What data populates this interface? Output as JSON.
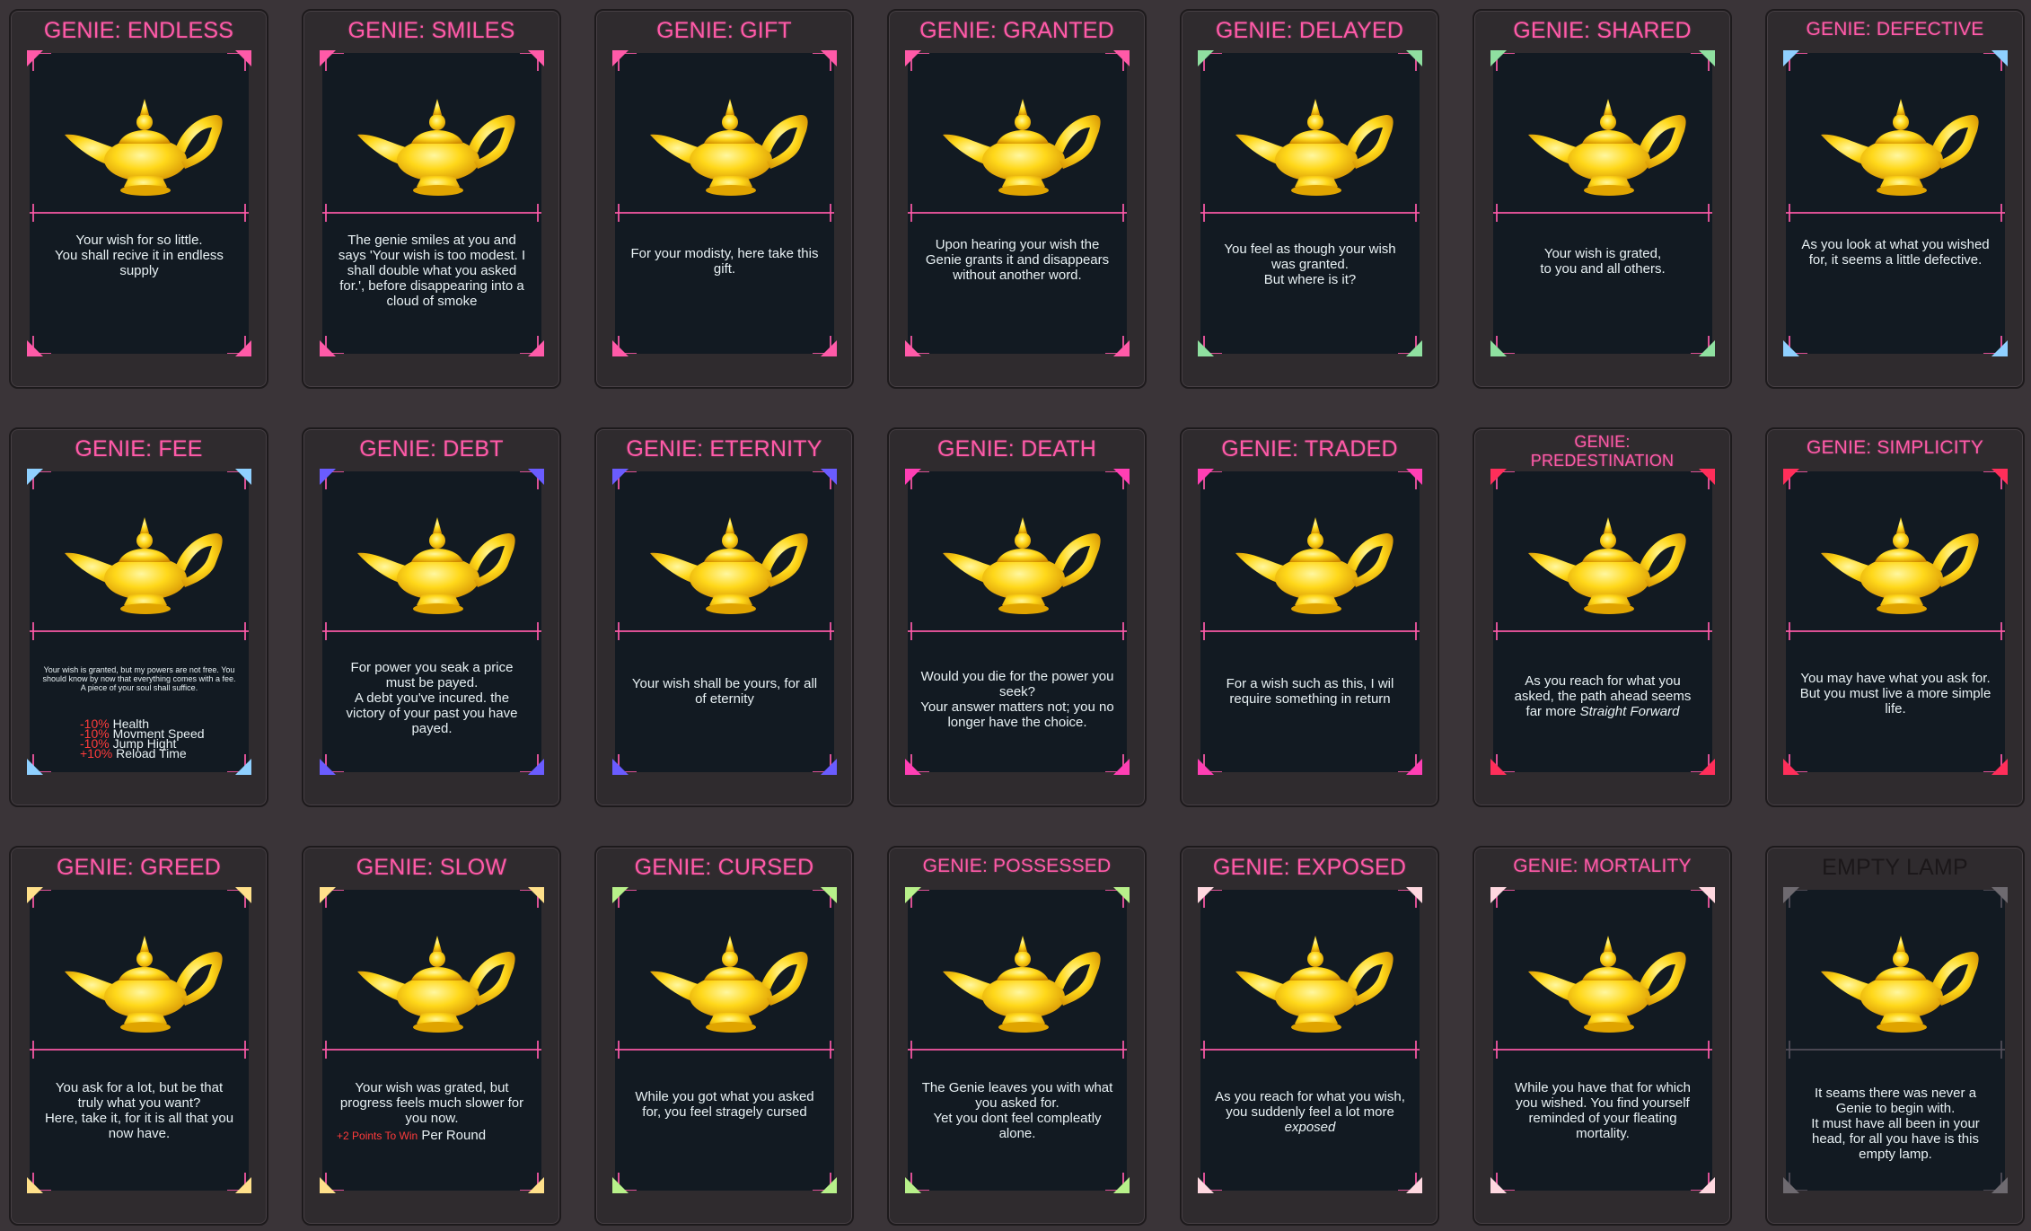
{
  "cards": [
    {
      "title": "GENIE: ENDLESS",
      "text": "Your wish for so little.\nYou shall recive it in endless supply",
      "corner_color": "#ff5aa8"
    },
    {
      "title": "GENIE: SMILES",
      "text": "The genie smiles at you and says 'Your wish is too modest. I shall double what you asked for.', before disappearing into a cloud of smoke",
      "corner_color": "#ff5aa8"
    },
    {
      "title": "GENIE: GIFT",
      "text": "For your modisty, here take this gift.",
      "corner_color": "#ff5aa8"
    },
    {
      "title": "GENIE: GRANTED",
      "text": "Upon hearing your wish the Genie grants it and disappears without another word.",
      "corner_color": "#ff5aa8"
    },
    {
      "title": "GENIE: DELAYED",
      "text": "You feel as though your wish was granted.\nBut where is it?",
      "corner_color": "#8fe0a0"
    },
    {
      "title": "GENIE: SHARED",
      "text": "Your wish is grated,\nto you and all others.",
      "corner_color": "#8fe0a0"
    },
    {
      "title": "GENIE: DEFECTIVE",
      "text": "As you look at what you wished for, it seems a little defective.",
      "corner_color": "#8fd0ff"
    },
    {
      "title": "GENIE: FEE",
      "text": "Your wish is granted, but my powers are not free. You should know by now that everything comes with a fee. A piece of your soul shall suffice.",
      "corner_color": "#8fd0ff",
      "stats": [
        {
          "value": "-10%",
          "label": "Health"
        },
        {
          "value": "-10%",
          "label": "Movment Speed"
        },
        {
          "value": "-10%",
          "label": "Jump Hight"
        },
        {
          "value": "+10%",
          "label": "Reload Time"
        }
      ]
    },
    {
      "title": "GENIE: DEBT",
      "text": "For power you seak a price must be payed.\nA debt you've incured. the victory of your past you have payed.",
      "corner_color": "#6a5cff"
    },
    {
      "title": "GENIE: ETERNITY",
      "text": "Your wish shall be yours, for all of eternity",
      "corner_color": "#6a5cff"
    },
    {
      "title": "GENIE: DEATH",
      "text": "Would you die for the power you seek?\nYour answer matters not; you no longer have the choice.",
      "corner_color": "#ff3fb4"
    },
    {
      "title": "GENIE: TRADED",
      "text": "For a wish such as this, I wil require something in return",
      "corner_color": "#ff3fb4"
    },
    {
      "title": "GENIE:\nPREDESTINATION",
      "text_pre": "As you reach for what you asked, the path ahead seems far more ",
      "text_em": "Straight Forward",
      "corner_color": "#ff2e5a"
    },
    {
      "title": "GENIE: SIMPLICITY",
      "text": "You may have what you ask for.\nBut you must live a more simple life.",
      "corner_color": "#ff2e5a"
    },
    {
      "title": "GENIE: GREED",
      "text": "You ask for a lot, but be that truly what you want?\nHere, take it, for it is all that you now have.",
      "corner_color": "#ffe08a"
    },
    {
      "title": "GENIE: SLOW",
      "text": "Your wish was grated, but progress feels much slower for you now.",
      "extra_red": "+2 Points To Win",
      "extra_white": "Per Round",
      "corner_color": "#ffe08a"
    },
    {
      "title": "GENIE: CURSED",
      "text": "While you got what you asked for, you feel stragely cursed",
      "corner_color": "#b8f08a"
    },
    {
      "title": "GENIE: POSSESSED",
      "text": "The Genie leaves you with what you asked for.\nYet you dont feel compleatly alone.",
      "corner_color": "#b8f08a"
    },
    {
      "title": "GENIE: EXPOSED",
      "text_pre": "As you reach for what you wish, you suddenly feel a lot more ",
      "text_em": "exposed",
      "corner_color": "#ffd8e0"
    },
    {
      "title": "GENIE: MORTALITY",
      "text": "While you have that for which you wished. You find yourself reminded of your fleating mortality.",
      "corner_color": "#ffd8e0"
    },
    {
      "title": "EMPTY LAMP",
      "text": "It seams there was never a Genie to begin with.\nIt must have all been in your head, for all you have is this empty lamp.",
      "corner_color": "#6e6a70"
    }
  ]
}
